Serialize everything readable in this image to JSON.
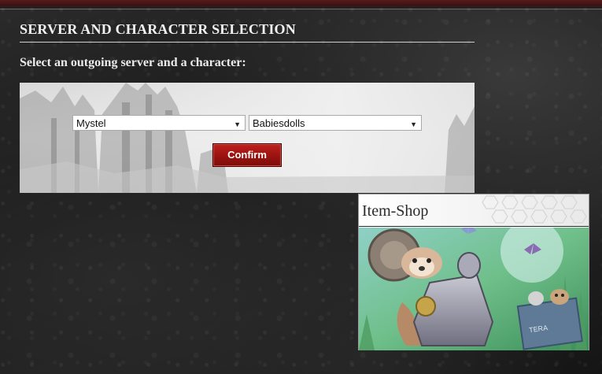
{
  "page": {
    "title": "SERVER AND CHARACTER SELECTION",
    "subtitle": "Select an outgoing server and a character:"
  },
  "form": {
    "server_select": {
      "value": "Mystel",
      "icon": "dropdown-arrow-icon"
    },
    "character_select": {
      "value": "Babiesdolls",
      "icon": "dropdown-arrow-icon"
    },
    "confirm_label": "Confirm"
  },
  "item_shop": {
    "title": "Item-Shop"
  },
  "colors": {
    "confirm_button": "#9c1410",
    "page_background": "#1e1e1e",
    "title_text": "#f2f2f2",
    "top_bar": "#4a1517"
  },
  "glyphs": {
    "dropdown_arrow": "▼"
  }
}
